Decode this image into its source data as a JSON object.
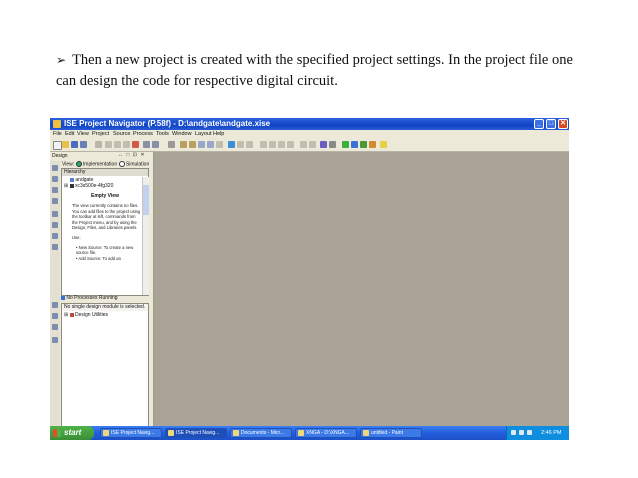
{
  "caption": {
    "bullet": "➢",
    "text": "Then a new project is created with the specified project settings. In the project file one can design the code for respective digital circuit."
  },
  "window": {
    "title": "ISE Project Navigator (P.58f) - D:\\andgate\\andgate.xise",
    "minimize": "_",
    "maximize": "□",
    "close": "✕"
  },
  "menu": [
    "File",
    "Edit",
    "View",
    "Project",
    "Source",
    "Process",
    "Tools",
    "Window",
    "Layout",
    "Help"
  ],
  "design_panel": {
    "label": "Design",
    "controls": "↔ □ ⊡ ✕",
    "view_label": "View:",
    "view_implementation": "Implementation",
    "view_simulation": "Simulation",
    "hierarchy_header": "Hierarchy",
    "tree_project": "andgate",
    "tree_device": "xc3s500e-4fg320",
    "empty_title": "Empty View",
    "empty_text": "The view currently contains no files. You can add files to the project using the toolbar at left, commands from the Project menu, and by using the Design, Files, and Libraries panels.",
    "use_label": "Use:",
    "new_source": "• New Source: To create a new source file.",
    "add_source": "• Add Source: To add an"
  },
  "process_panel": {
    "status": "No Processes Running",
    "selected": "No single design module is selected.",
    "item": "Design Utilities"
  },
  "taskbar": {
    "start": "start",
    "tasks": [
      "ISE Project Navig...",
      "ISE Project Navig...",
      "Documents - Micr...",
      "XNGA - D:\\XNGA...",
      "untitled - Paint"
    ],
    "clock": "2:46 PM"
  },
  "colors": {
    "title_blue": "#0f44c5",
    "workarea": "#aaa496",
    "taskbar": "#245edc",
    "start_green": "#3a8e35"
  }
}
